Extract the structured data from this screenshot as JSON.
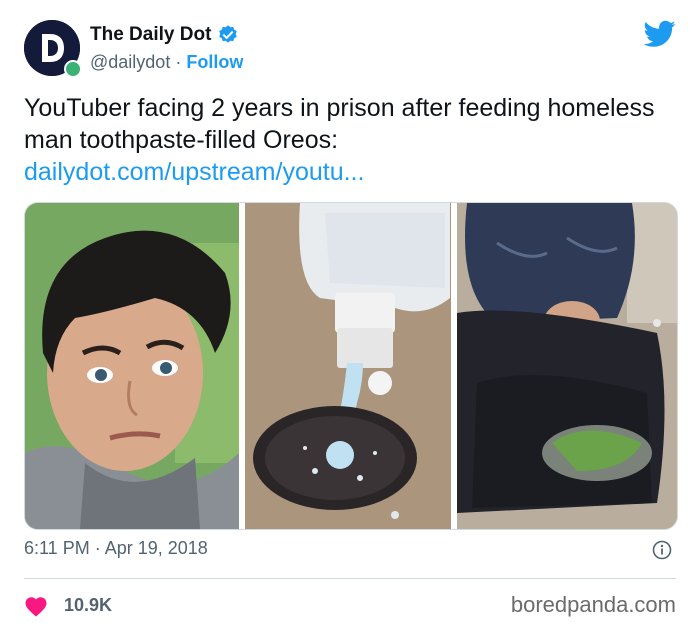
{
  "author": {
    "name": "The Daily Dot",
    "handle": "@dailydot",
    "separator": "·",
    "follow_label": "Follow"
  },
  "tweet": {
    "text": "YouTuber facing 2 years in prison after feeding homeless man toothpaste-filled Oreos:",
    "link": "dailydot.com/upstream/youtu..."
  },
  "meta": {
    "timestamp": "6:11 PM · Apr 19, 2018"
  },
  "footer": {
    "likes": "10.9K",
    "watermark": "boredpanda.com"
  },
  "icons": {
    "verified": "verified-badge-icon",
    "twitter": "twitter-bird-icon",
    "info": "info-icon",
    "like": "heart-icon"
  },
  "colors": {
    "accent": "#1d9bf0",
    "like": "#f91880",
    "secondary_text": "#536471",
    "online": "#3bb273"
  }
}
